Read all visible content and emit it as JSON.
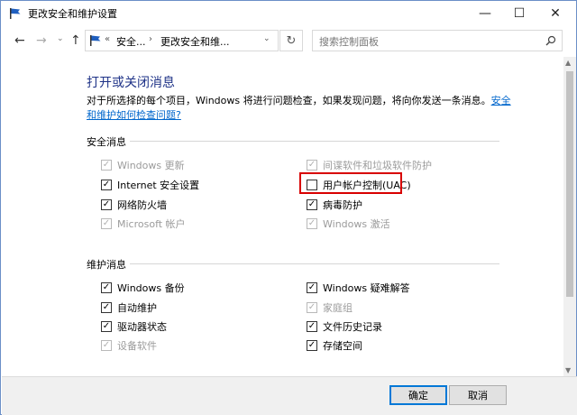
{
  "window": {
    "title": "更改安全和维护设置",
    "minimize_glyph": "—",
    "maximize_glyph": "☐",
    "close_glyph": "✕"
  },
  "nav": {
    "back_glyph": "←",
    "forward_glyph": "→",
    "recent_glyph": "⌄",
    "up_glyph": "↑",
    "address_prefix": "«",
    "address_segment_1": "安全...",
    "address_arrow": "›",
    "address_segment_2": "更改安全和维...",
    "address_dropdown_glyph": "⌄",
    "refresh_glyph": "↻",
    "search_placeholder": "搜索控制面板"
  },
  "main": {
    "heading": "打开或关闭消息",
    "description": "对于所选择的每个项目，Windows 将进行问题检查，如果发现问题，将向你发送一条消息。",
    "description_link": "安全和维护如何检查问题?"
  },
  "security": {
    "label": "安全消息",
    "items": [
      {
        "label": "Windows 更新",
        "checked": true,
        "disabled": true
      },
      {
        "label": "间谍软件和垃圾软件防护",
        "checked": true,
        "disabled": true
      },
      {
        "label": "Internet 安全设置",
        "checked": true,
        "disabled": false
      },
      {
        "label": "用户帐户控制(UAC)",
        "checked": false,
        "disabled": false
      },
      {
        "label": "网络防火墙",
        "checked": true,
        "disabled": false
      },
      {
        "label": "病毒防护",
        "checked": true,
        "disabled": false
      },
      {
        "label": "Microsoft 帐户",
        "checked": true,
        "disabled": true
      },
      {
        "label": "Windows 激活",
        "checked": true,
        "disabled": true
      }
    ]
  },
  "maintenance": {
    "label": "维护消息",
    "items": [
      {
        "label": "Windows 备份",
        "checked": true,
        "disabled": false
      },
      {
        "label": "Windows 疑难解答",
        "checked": true,
        "disabled": false
      },
      {
        "label": "自动维护",
        "checked": true,
        "disabled": false
      },
      {
        "label": "家庭组",
        "checked": true,
        "disabled": true
      },
      {
        "label": "驱动器状态",
        "checked": true,
        "disabled": false
      },
      {
        "label": "文件历史记录",
        "checked": true,
        "disabled": false
      },
      {
        "label": "设备软件",
        "checked": true,
        "disabled": true
      },
      {
        "label": "存储空间",
        "checked": true,
        "disabled": false
      }
    ]
  },
  "footer": {
    "ok_label": "确定",
    "cancel_label": "取消"
  },
  "colors": {
    "heading": "#1e3287",
    "link": "#0066cc",
    "highlight": "#d80000",
    "disabled_text": "#9b9b9b"
  },
  "icons": {
    "title": "flag-icon",
    "address": "flag-icon",
    "search": "search-icon"
  }
}
